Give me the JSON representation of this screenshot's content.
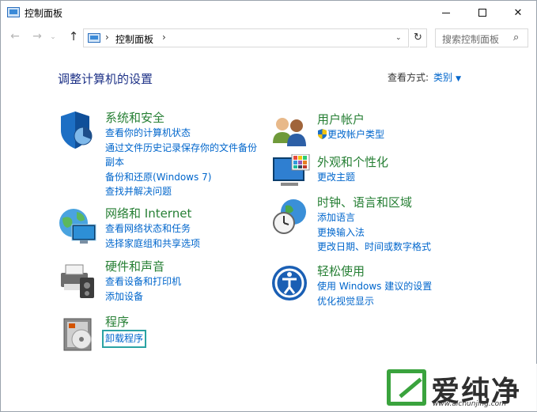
{
  "window": {
    "title": "控制面板",
    "minimize": "─",
    "maximize": "□",
    "close": "✕"
  },
  "navbar": {
    "back": "←",
    "forward": "→",
    "history": "⌄",
    "up": "↑",
    "sep": "›",
    "breadcrumb": "控制面板",
    "dropdown": "⌄",
    "refresh": "↻",
    "search_placeholder": "搜索控制面板",
    "search_icon": "⌕"
  },
  "main": {
    "heading": "调整计算机的设置",
    "view_by_label": "查看方式:",
    "view_by_value": "类别",
    "view_by_caret": "▼"
  },
  "categories": {
    "system_security": {
      "title": "系统和安全",
      "links": [
        "查看你的计算机状态",
        "通过文件历史记录保存你的文件备份",
        "副本",
        "备份和还原(Windows 7)",
        "查找并解决问题"
      ]
    },
    "network": {
      "title": "网络和 Internet",
      "links": [
        "查看网络状态和任务",
        "选择家庭组和共享选项"
      ]
    },
    "hardware": {
      "title": "硬件和声音",
      "links": [
        "查看设备和打印机",
        "添加设备"
      ]
    },
    "programs": {
      "title": "程序",
      "links": [
        "卸载程序"
      ]
    },
    "user_accounts": {
      "title": "用户帐户",
      "links": [
        "更改帐户类型"
      ]
    },
    "appearance": {
      "title": "外观和个性化",
      "links": [
        "更改主题"
      ]
    },
    "clock_region": {
      "title": "时钟、语言和区域",
      "links": [
        "添加语言",
        "更换输入法",
        "更改日期、时间或数字格式"
      ]
    },
    "ease_of_access": {
      "title": "轻松使用",
      "links": [
        "使用 Windows 建议的设置",
        "优化视觉显示"
      ]
    }
  },
  "watermark": {
    "brand": "爱纯净",
    "url": "www.aichunjing.com"
  },
  "colors": {
    "title_green": "#267f34",
    "link_blue": "#0066cc",
    "heading_blue": "#1e3287",
    "highlight": "#2aa3a3"
  }
}
